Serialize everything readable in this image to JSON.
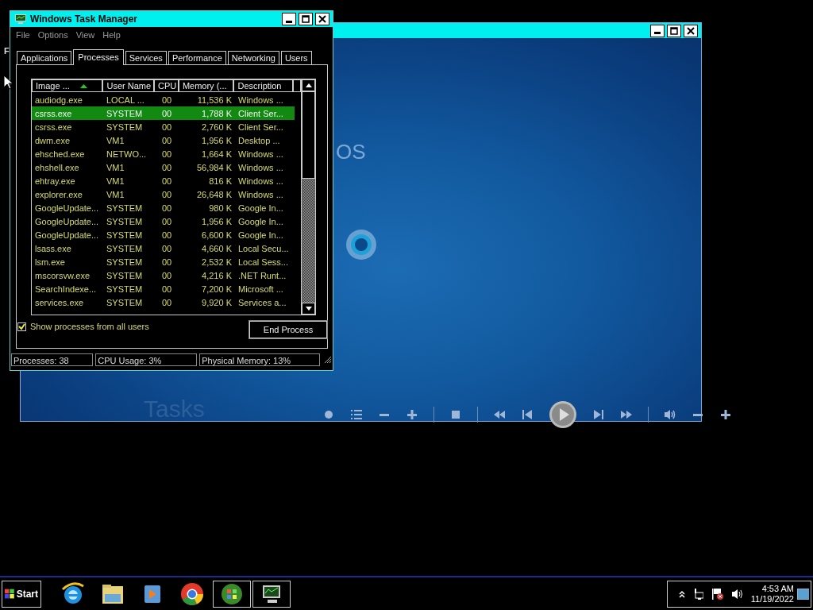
{
  "desktop": {
    "label": "F"
  },
  "media_window": {
    "texts": [
      {
        "kind": "heading",
        "text": "OS"
      },
      {
        "kind": "menu",
        "text": "Tasks"
      }
    ],
    "controls": [
      {
        "kind": "dot"
      },
      {
        "kind": "list"
      },
      {
        "kind": "minus"
      },
      {
        "kind": "plus"
      },
      {
        "kind": "sep"
      },
      {
        "kind": "stop"
      },
      {
        "kind": "sep"
      },
      {
        "kind": "rewind"
      },
      {
        "kind": "prev"
      },
      {
        "kind": "play"
      },
      {
        "kind": "next"
      },
      {
        "kind": "ffwd"
      },
      {
        "kind": "sep"
      },
      {
        "kind": "volume"
      },
      {
        "kind": "minus"
      },
      {
        "kind": "plus"
      }
    ]
  },
  "task_manager": {
    "title": "Windows Task Manager",
    "menu": [
      "File",
      "Options",
      "View",
      "Help"
    ],
    "tabs": [
      {
        "label": "Applications",
        "selected": false
      },
      {
        "label": "Processes",
        "selected": true
      },
      {
        "label": "Services",
        "selected": false
      },
      {
        "label": "Performance",
        "selected": false
      },
      {
        "label": "Networking",
        "selected": false
      },
      {
        "label": "Users",
        "selected": false
      }
    ],
    "columns": [
      {
        "label": "Image ...",
        "sorted": true
      },
      {
        "label": "User Name",
        "sorted": false
      },
      {
        "label": "CPU",
        "sorted": false
      },
      {
        "label": "Memory (...",
        "sorted": false
      },
      {
        "label": "Description",
        "sorted": false
      }
    ],
    "rows": [
      {
        "cells": [
          "audiodg.exe",
          "LOCAL ...",
          "00",
          "11,536 K",
          "Windows ..."
        ],
        "selected": false
      },
      {
        "cells": [
          "csrss.exe",
          "SYSTEM",
          "00",
          "1,788 K",
          "Client Ser..."
        ],
        "selected": true
      },
      {
        "cells": [
          "csrss.exe",
          "SYSTEM",
          "00",
          "2,760 K",
          "Client Ser..."
        ],
        "selected": false
      },
      {
        "cells": [
          "dwm.exe",
          "VM1",
          "00",
          "1,956 K",
          "Desktop ..."
        ],
        "selected": false
      },
      {
        "cells": [
          "ehsched.exe",
          "NETWO...",
          "00",
          "1,664 K",
          "Windows ..."
        ],
        "selected": false
      },
      {
        "cells": [
          "ehshell.exe",
          "VM1",
          "00",
          "56,984 K",
          "Windows ..."
        ],
        "selected": false
      },
      {
        "cells": [
          "ehtray.exe",
          "VM1",
          "00",
          "816 K",
          "Windows ..."
        ],
        "selected": false
      },
      {
        "cells": [
          "explorer.exe",
          "VM1",
          "00",
          "26,648 K",
          "Windows ..."
        ],
        "selected": false
      },
      {
        "cells": [
          "GoogleUpdate...",
          "SYSTEM",
          "00",
          "980 K",
          "Google In..."
        ],
        "selected": false
      },
      {
        "cells": [
          "GoogleUpdate...",
          "SYSTEM",
          "00",
          "1,956 K",
          "Google In..."
        ],
        "selected": false
      },
      {
        "cells": [
          "GoogleUpdate...",
          "SYSTEM",
          "00",
          "6,600 K",
          "Google In..."
        ],
        "selected": false
      },
      {
        "cells": [
          "lsass.exe",
          "SYSTEM",
          "00",
          "4,660 K",
          "Local Secu..."
        ],
        "selected": false
      },
      {
        "cells": [
          "lsm.exe",
          "SYSTEM",
          "00",
          "2,532 K",
          "Local Sess..."
        ],
        "selected": false
      },
      {
        "cells": [
          "mscorsvw.exe",
          "SYSTEM",
          "00",
          "4,216 K",
          ".NET Runt..."
        ],
        "selected": false
      },
      {
        "cells": [
          "SearchIndexe...",
          "SYSTEM",
          "00",
          "7,200 K",
          "Microsoft ..."
        ],
        "selected": false
      },
      {
        "cells": [
          "services.exe",
          "SYSTEM",
          "00",
          "9,920 K",
          "Services a..."
        ],
        "selected": false
      }
    ],
    "show_all": {
      "label": "Show processes from all users",
      "checked": true
    },
    "end_button": "End Process",
    "status": [
      "Processes: 38",
      "CPU Usage: 3%",
      "Physical Memory: 13%"
    ]
  },
  "taskbar": {
    "start": "Start",
    "apps": [
      {
        "kind": "browser",
        "running": false
      },
      {
        "kind": "folder",
        "running": false
      },
      {
        "kind": "player",
        "running": false
      },
      {
        "kind": "chrome",
        "running": false
      },
      {
        "kind": "media-center",
        "running": true
      },
      {
        "kind": "monitor",
        "running": true
      }
    ],
    "clock": {
      "time": "4:53 AM",
      "date": "11/19/2022"
    }
  }
}
